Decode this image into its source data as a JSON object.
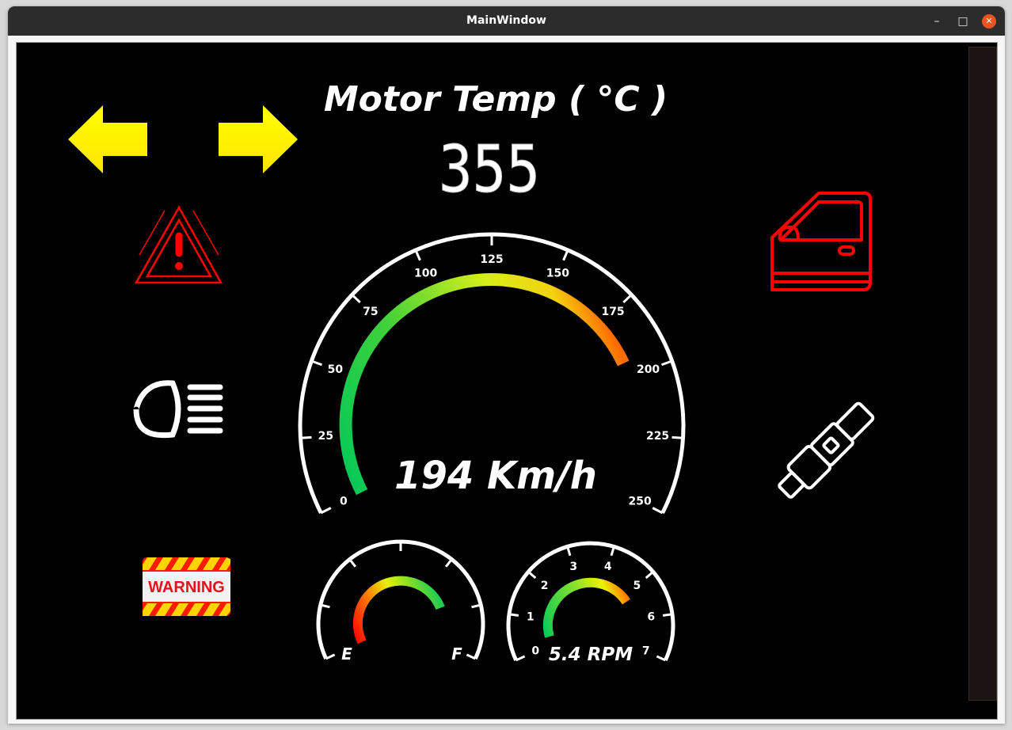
{
  "window": {
    "title": "MainWindow",
    "min_glyph": "–",
    "max_glyph": "□",
    "close_glyph": "✕"
  },
  "dashboard": {
    "motor_temp": {
      "title": "Motor Temp ( °C )",
      "value": "355"
    },
    "speedometer": {
      "readout": "194 Km/h",
      "min": 0,
      "max": 250,
      "value": 194,
      "arc_max": 194,
      "ticks": [
        "0",
        "25",
        "50",
        "75",
        "100",
        "125",
        "150",
        "175",
        "200",
        "225",
        "250"
      ]
    },
    "fuel_gauge": {
      "empty_label": "E",
      "full_label": "F",
      "level": 0.62
    },
    "rpm_gauge": {
      "readout": "5.4 RPM",
      "min": 0,
      "max": 7,
      "value": 5.4,
      "ticks": [
        "0",
        "1",
        "2",
        "3",
        "4",
        "5",
        "6",
        "7"
      ]
    },
    "warning_label": "WARNING",
    "icons": {
      "left_turn": "left-arrow-icon",
      "right_turn": "right-arrow-icon",
      "hazard": "hazard-triangle-icon",
      "headlight": "headlight-icon",
      "warning": "warning-sign-icon",
      "door": "car-door-icon",
      "seatbelt": "seatbelt-icon"
    },
    "colors": {
      "background": "#000000",
      "turn_signal": "#ffee00",
      "alert_red": "#ff0000",
      "gauge_white": "#ffffff",
      "gauge_green": "#00cc55",
      "gauge_yellow": "#e8f000",
      "gauge_red": "#ff2200"
    }
  }
}
